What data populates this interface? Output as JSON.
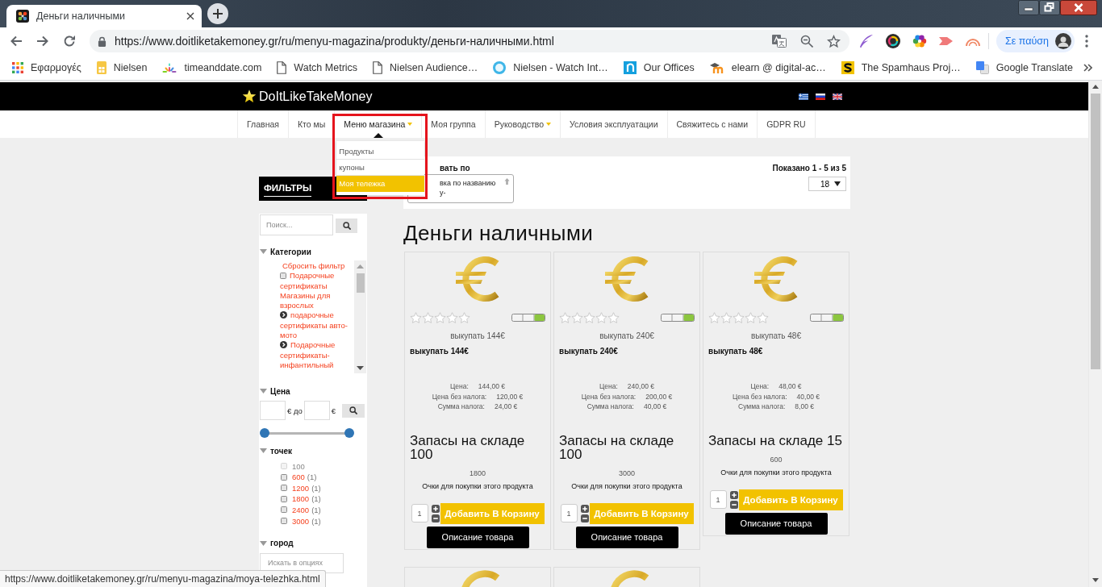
{
  "browser": {
    "tab": {
      "title": "Деньги наличными",
      "selected": true
    },
    "address": "https://www.doitliketakemoney.gr/ru/menyu-magazina/produkty/деньги-наличными.html",
    "profile": "Σε παύση",
    "bookmarks": [
      {
        "label": "Εφαρμογές",
        "kind": "apps"
      },
      {
        "label": "Nielsen",
        "kind": "note"
      },
      {
        "label": "timeanddate.com",
        "kind": "burst"
      },
      {
        "label": "Watch Metrics",
        "kind": "page"
      },
      {
        "label": "Nielsen Audience…",
        "kind": "page"
      },
      {
        "label": "Nielsen - Watch Int…",
        "kind": "disc"
      },
      {
        "label": "Our Offices",
        "kind": "tile"
      },
      {
        "label": "elearn @ digital-ac…",
        "kind": "cap"
      },
      {
        "label": "The Spamhaus Proj…",
        "kind": "stripe"
      },
      {
        "label": "Google Translate",
        "kind": "translate"
      }
    ]
  },
  "site": {
    "logo": "DoItLikeTakeMoney",
    "flags": [
      {
        "kind": "greek"
      },
      {
        "kind": "russian"
      },
      {
        "kind": "british"
      }
    ],
    "nav": [
      {
        "label": "Главная",
        "has_menu": false,
        "expanded": false
      },
      {
        "label": "Кто мы",
        "has_menu": false,
        "expanded": false
      },
      {
        "label": "Меню магазина",
        "has_menu": true,
        "expanded": true,
        "items": [
          {
            "label": "Продукты",
            "selected": false
          },
          {
            "label": "купоны",
            "selected": false
          },
          {
            "label": "Моя тележка",
            "selected": true
          }
        ]
      },
      {
        "label": "Моя группа",
        "has_menu": false,
        "expanded": false
      },
      {
        "label": "Руководство",
        "has_menu": true,
        "expanded": false
      },
      {
        "label": "Условия эксплуатации",
        "has_menu": false,
        "expanded": false
      },
      {
        "label": "Свяжитесь с нами",
        "has_menu": false,
        "expanded": false
      },
      {
        "label": "GDPR RU",
        "has_menu": false,
        "expanded": false
      }
    ]
  },
  "filters": {
    "title": "ФИЛЬТРЫ",
    "search": {
      "placeholder": "Поиск..."
    },
    "categories": {
      "title": "Категории",
      "expanded": true,
      "reset": "Сбросить фильтр",
      "items": [
        {
          "kind": "checkbox",
          "label": "Подарочные сертификаты Магазины для взрослых",
          "checked": false
        },
        {
          "kind": "expander",
          "label": "подарочные сертификаты авто-мото"
        },
        {
          "kind": "expander",
          "label": "Подарочные сертификаты-инфантильный"
        }
      ]
    },
    "price": {
      "title": "Цена",
      "expanded": true,
      "from_unit": "€ до",
      "to_unit": "€",
      "handles": [
        {
          "level": 0
        },
        {
          "level": 1
        }
      ]
    },
    "points": {
      "title": "точек",
      "expanded": true,
      "options": [
        {
          "value": "100",
          "checked": false,
          "disabled": true
        },
        {
          "value": "600",
          "count": "(1)",
          "checked": false,
          "disabled": false
        },
        {
          "value": "1200",
          "count": "(1)",
          "checked": false,
          "disabled": false
        },
        {
          "value": "1800",
          "count": "(1)",
          "checked": false,
          "disabled": false
        },
        {
          "value": "2400",
          "count": "(1)",
          "checked": false,
          "disabled": false
        },
        {
          "value": "3000",
          "count": "(1)",
          "checked": false,
          "disabled": false
        }
      ]
    },
    "city": {
      "title": "город",
      "expanded": true,
      "search": {
        "placeholder": "Искать в опциях"
      }
    }
  },
  "sorting": {
    "label": "вать по",
    "select_lines": [
      "вка по названию",
      "у-"
    ],
    "results": "Показано 1 - 5 из 5",
    "per_page": "18"
  },
  "category_title": "Деньги наличными",
  "products": [
    {
      "kind": "full",
      "stars": 0,
      "subtitle": "выкупать 144€",
      "name": "выкупать 144€",
      "prices": [
        {
          "label": "Цена:",
          "value": "144,00 €"
        },
        {
          "label": "Цена без налога:",
          "value": "120,00 €"
        },
        {
          "label": "Сумма налога:",
          "value": "24,00 €"
        }
      ],
      "stock": "Запасы на складе 100",
      "points": "1800",
      "points_caption": "Очки для покупки этого продукта",
      "quantity": "1",
      "add_button": "Добавить В Корзину",
      "details_button": "Описание товара"
    },
    {
      "kind": "full",
      "stars": 0,
      "subtitle": "выкупать 240€",
      "name": "выкупать 240€",
      "prices": [
        {
          "label": "Цена:",
          "value": "240,00 €"
        },
        {
          "label": "Цена без налога:",
          "value": "200,00 €"
        },
        {
          "label": "Сумма налога:",
          "value": "40,00 €"
        }
      ],
      "stock": "Запасы на складе 100",
      "points": "3000",
      "points_caption": "Очки для покупки этого продукта",
      "quantity": "1",
      "add_button": "Добавить В Корзину",
      "details_button": "Описание товара"
    },
    {
      "kind": "full",
      "stars": 0,
      "subtitle": "выкупать 48€",
      "name": "выкупать 48€",
      "prices": [
        {
          "label": "Цена:",
          "value": "48,00 €"
        },
        {
          "label": "Цена без налога:",
          "value": "40,00 €"
        },
        {
          "label": "Сумма налога:",
          "value": "8,00 €"
        }
      ],
      "stock": "Запасы на складе 15",
      "points": "600",
      "points_caption": "Очки для покупки этого продукта",
      "quantity": "1",
      "add_button": "Добавить В Корзину",
      "details_button": "Описание товара"
    },
    {
      "kind": "partial"
    },
    {
      "kind": "partial"
    }
  ],
  "status_bar": "https://www.doitliketakemoney.gr/ru/menyu-magazina/moya-telezhka.html"
}
